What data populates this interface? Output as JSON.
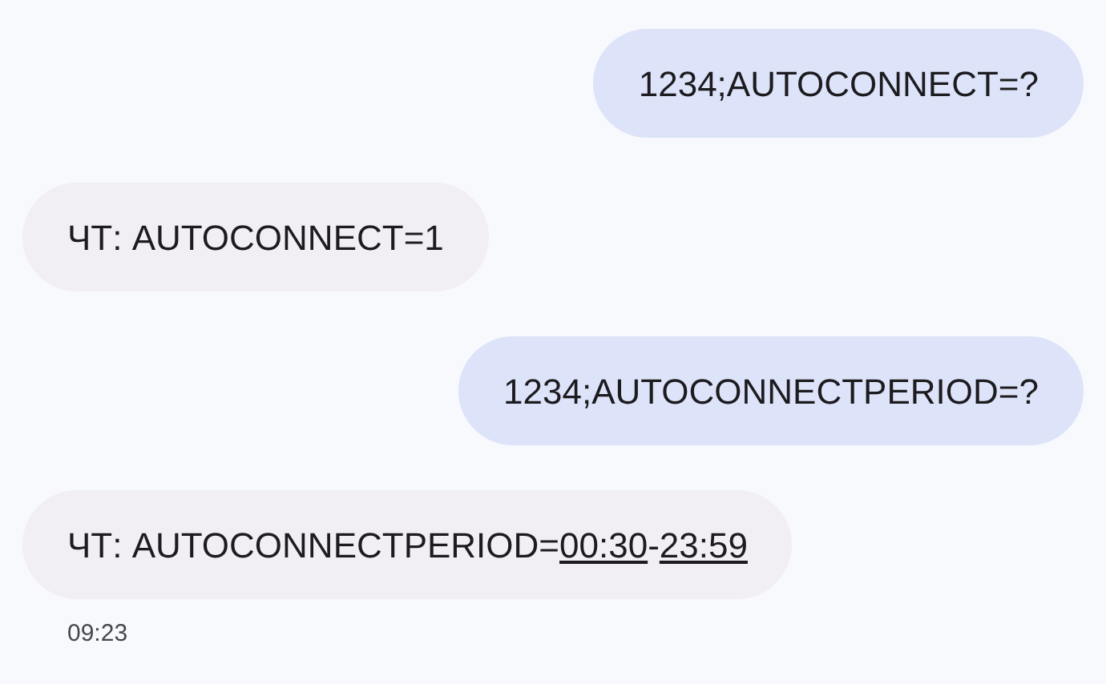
{
  "messages": [
    {
      "kind": "sent",
      "parts": [
        {
          "kind": "plain",
          "text": "1234;AUTOCONNECT=?"
        }
      ]
    },
    {
      "kind": "received",
      "parts": [
        {
          "kind": "plain",
          "text": "ЧТ: AUTOCONNECT=1"
        }
      ]
    },
    {
      "kind": "sent",
      "parts": [
        {
          "kind": "plain",
          "text": "1234;AUTOCONNECTPERIOD=?"
        }
      ]
    },
    {
      "kind": "received",
      "parts": [
        {
          "kind": "plain",
          "text": "ЧТ: AUTOCONNECTPERIOD="
        },
        {
          "kind": "link",
          "text": "00:30"
        },
        {
          "kind": "plain",
          "text": "-"
        },
        {
          "kind": "link",
          "text": "23:59"
        }
      ]
    }
  ],
  "timestamp": "09:23"
}
